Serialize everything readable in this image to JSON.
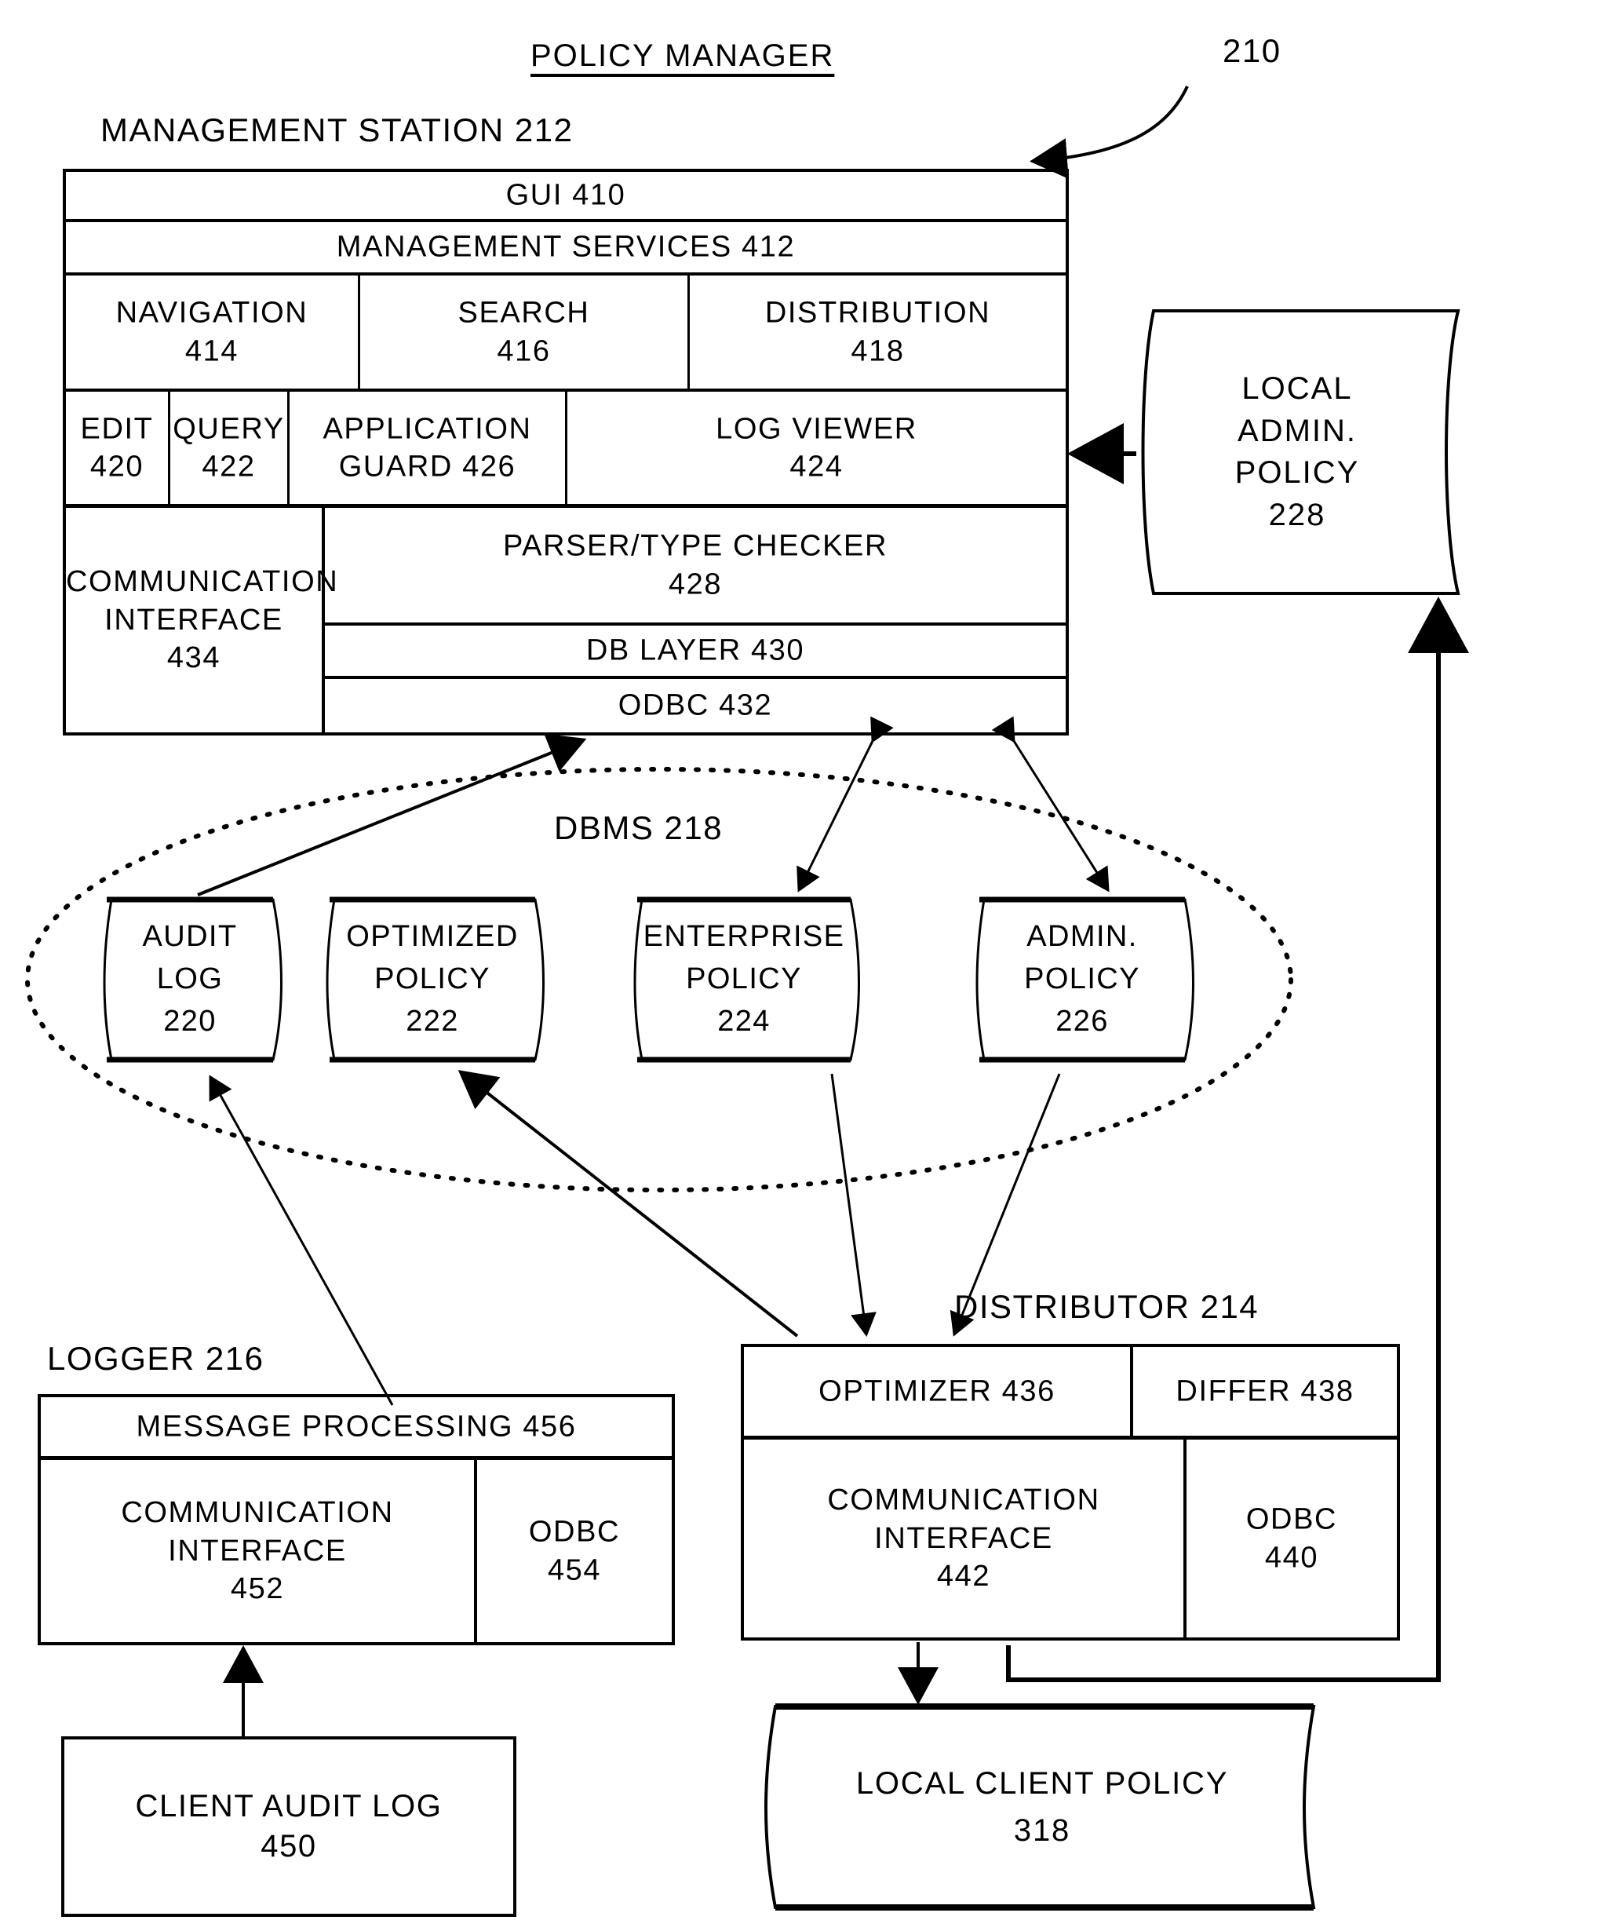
{
  "figure": {
    "title": "POLICY MANAGER",
    "ref_number": "210"
  },
  "management_station": {
    "label": "MANAGEMENT STATION  212",
    "rows": {
      "gui": "GUI   410",
      "management_services": "MANAGEMENT SERVICES   412",
      "navigation": "NAVIGATION\n414",
      "search": "SEARCH\n416",
      "distribution": "DISTRIBUTION\n418",
      "edit": "EDIT\n420",
      "query": "QUERY\n422",
      "application_guard": "APPLICATION\nGUARD   426",
      "log_viewer": "LOG VIEWER\n424",
      "communication_interface": "COMMUNICATION\nINTERFACE\n434",
      "parser_type_checker": "PARSER/TYPE CHECKER\n428",
      "db_layer": "DB LAYER   430",
      "odbc": "ODBC   432"
    }
  },
  "local_admin_policy": {
    "text": "LOCAL\nADMIN.\nPOLICY\n228"
  },
  "dbms": {
    "label": "DBMS   218",
    "stores": [
      {
        "text": "AUDIT\nLOG\n220"
      },
      {
        "text": "OPTIMIZED\nPOLICY\n222"
      },
      {
        "text": "ENTERPRISE\nPOLICY\n224"
      },
      {
        "text": "ADMIN.\nPOLICY\n226"
      }
    ]
  },
  "logger": {
    "label": "LOGGER  216",
    "message_processing": "MESSAGE PROCESSING  456",
    "communication_interface": "COMMUNICATION\nINTERFACE\n452",
    "odbc": "ODBC\n454"
  },
  "distributor": {
    "label": "DISTRIBUTOR 214",
    "optimizer": "OPTIMIZER  436",
    "differ": "DIFFER  438",
    "communication_interface": "COMMUNICATION\nINTERFACE\n442",
    "odbc": "ODBC\n440"
  },
  "client_audit_log": {
    "text": "CLIENT AUDIT LOG\n450"
  },
  "local_client_policy": {
    "text": "LOCAL CLIENT POLICY\n318"
  },
  "colors": {
    "stroke": "#000000",
    "background": "#ffffff"
  }
}
